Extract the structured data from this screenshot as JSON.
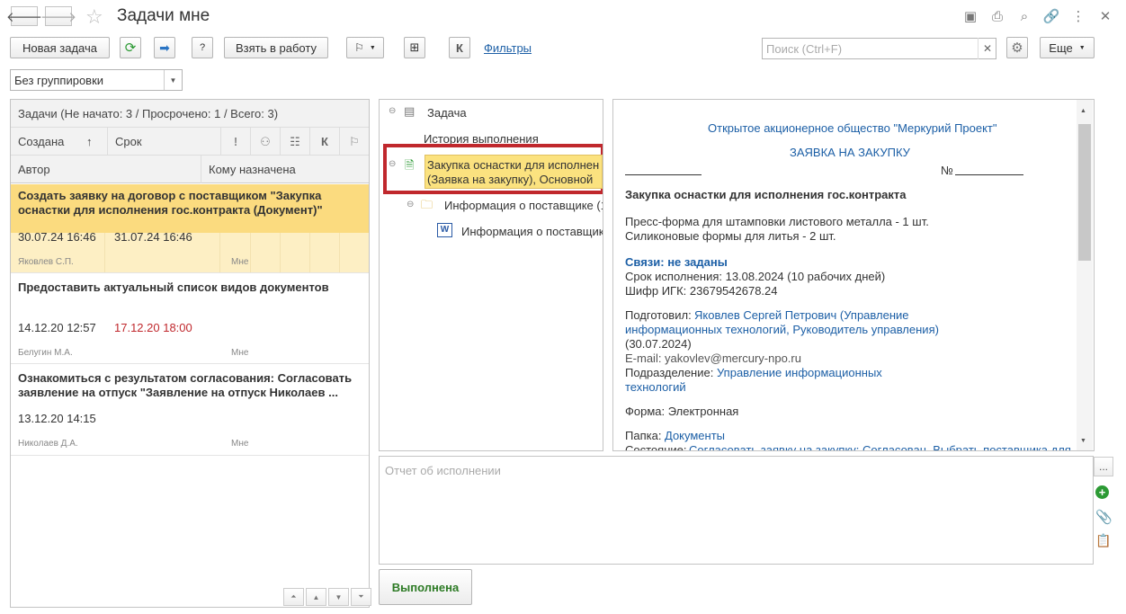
{
  "window": {
    "title": "Задачи мне"
  },
  "toolbar": {
    "new_task": "Новая задача",
    "take_to_work": "Взять в работу",
    "k_label": "К",
    "filters": "Фильтры",
    "search_placeholder": "Поиск (Ctrl+F)",
    "more": "Еще"
  },
  "grouping": {
    "value": "Без группировки"
  },
  "tasks": {
    "summary": "Задачи (Не начато: 3 / Просрочено: 1 / Всего: 3)",
    "columns": {
      "created": "Создана",
      "sort_arrow": "↑",
      "due": "Срок",
      "author": "Автор",
      "assignee": "Кому назначена",
      "k": "К"
    },
    "rows": [
      {
        "title": "Создать заявку на договор с поставщиком \"Закупка оснастки для исполнения гос.контракта (Документ)\"",
        "created": "30.07.24 16:46",
        "due": "31.07.24 16:46",
        "author": "Яковлев С.П.",
        "assignee": "Мне"
      },
      {
        "title": "Предоставить актуальный список видов документов",
        "created": "14.12.20 12:57",
        "due": "17.12.20 18:00",
        "author": "Белугин М.А.",
        "assignee": "Мне"
      },
      {
        "title": "Ознакомиться с результатом согласования: Согласовать заявление на отпуск \"Заявление на отпуск Николаев ...",
        "created": "13.12.20 14:15",
        "due": "",
        "author": "Николаев Д.А.",
        "assignee": "Мне"
      }
    ]
  },
  "tree": {
    "task": "Задача",
    "history": "История выполнения",
    "item_line1": "Закупка оснастки для исполнен",
    "item_line2": "(Заявка на закупку), Основной",
    "supplier_folder": "Информация о поставщике (1",
    "supplier_doc": "Информация о поставщик"
  },
  "document": {
    "org": "Открытое акционерное общество \"Меркурий Проект\"",
    "heading": "ЗАЯВКА НА ЗАКУПКУ",
    "number_label": "№",
    "subject": "Закупка оснастки для исполнения гос.контракта",
    "item1": "Пресс-форма для штамповки листового металла - 1 шт.",
    "item2": "Силиконовые формы для литья - 2 шт.",
    "links": "Связи: не заданы",
    "deadline": "Срок исполнения: 13.08.2024 (10 рабочих дней)",
    "code": "Шифр ИГК: 23679542678.24",
    "prepared_label": "Подготовил:",
    "prepared_line1": "Яковлев Сергей Петрович (Управление",
    "prepared_line2": "информационных технологий, Руководитель управления)",
    "prepared_date": "(30.07.2024)",
    "email": "E-mail: yakovlev@mercury-npo.ru",
    "dept_label": "Подразделение:",
    "dept_line1": "Управление информационных",
    "dept_line2": "технологий",
    "form": "Форма: Электронная",
    "folder_label": "Папка:",
    "folder_value": "Документы",
    "state_label": "Состояние:",
    "state_value": "Согласовать заявку на закупку: Согласован, Выбрать поставщика для"
  },
  "report": {
    "placeholder": "Отчет об исполнении",
    "more": "..."
  },
  "actions": {
    "done": "Выполнена"
  },
  "colors": {
    "selected_row": "#fbdb7f",
    "highlight_border": "#c0282d",
    "link": "#1c5fa6",
    "overdue": "#c0282d",
    "done_text": "#2c7a24"
  }
}
